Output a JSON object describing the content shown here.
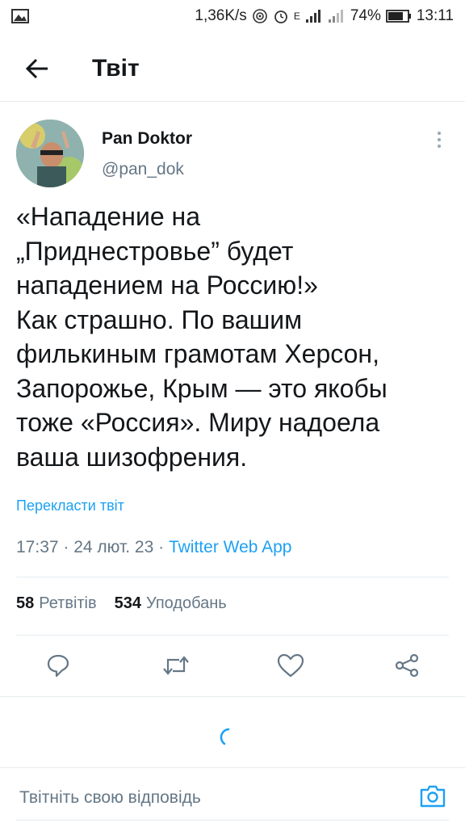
{
  "status_bar": {
    "speed": "1,36K/s",
    "network_letter": "E",
    "battery": "74%",
    "time": "13:11"
  },
  "header": {
    "title": "Твіт"
  },
  "tweet": {
    "author_name": "Pan Doktor",
    "author_handle": "@pan_dok",
    "text_lines": [
      "«Нападение на",
      "„Приднестровье” будет",
      "нападением на Россию!»",
      "Как страшно. По вашим",
      "филькиным грамотам Херсон,",
      "Запорожье, Крым — это якобы",
      "тоже «Россия». Миру надоела",
      "ваша шизофрения."
    ],
    "translate_label": "Перекласти твіт",
    "time": "17:37",
    "date": "24 лют. 23",
    "source_app": "Twitter Web App",
    "retweets_count": "58",
    "retweets_label": "Ретвітів",
    "likes_count": "534",
    "likes_label": "Уподобань"
  },
  "reply": {
    "placeholder": "Твітніть свою відповідь"
  },
  "colors": {
    "accent": "#1da1f2",
    "secondary_text": "#657786",
    "divider": "#e6ecf0"
  }
}
